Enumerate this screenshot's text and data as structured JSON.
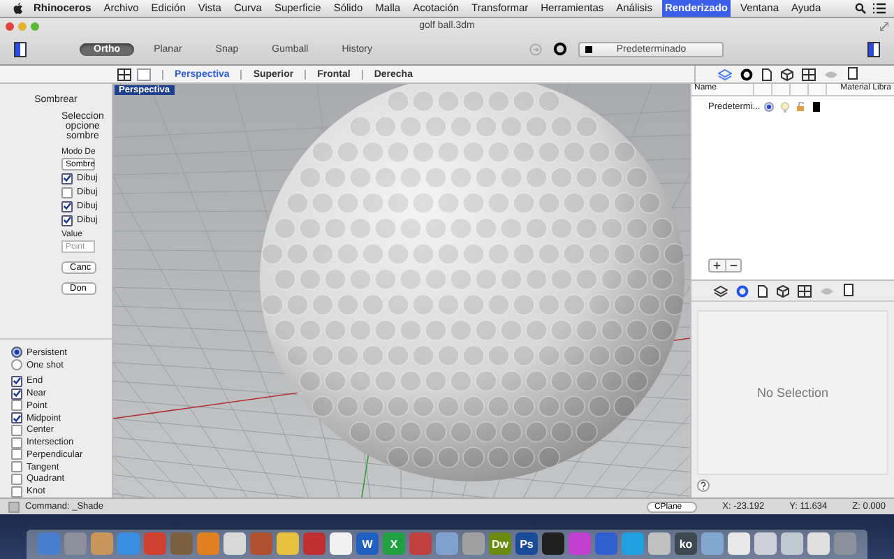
{
  "menubar": {
    "app": "Rhinoceros",
    "items": [
      {
        "label": "Archivo",
        "selected": false
      },
      {
        "label": "Edición",
        "selected": false
      },
      {
        "label": "Vista",
        "selected": false
      },
      {
        "label": "Curva",
        "selected": false
      },
      {
        "label": "Superficie",
        "selected": false
      },
      {
        "label": "Sólido",
        "selected": false
      },
      {
        "label": "Malla",
        "selected": false
      },
      {
        "label": "Acotación",
        "selected": false
      },
      {
        "label": "Transformar",
        "selected": false
      },
      {
        "label": "Herramientas",
        "selected": false
      },
      {
        "label": "Análisis",
        "selected": false
      },
      {
        "label": "Renderizado",
        "selected": true
      },
      {
        "label": "Ventana",
        "selected": false
      },
      {
        "label": "Ayuda",
        "selected": false
      }
    ]
  },
  "window": {
    "title": "golf ball.3dm"
  },
  "toolbar": {
    "toggles": [
      {
        "label": "Ortho",
        "selected": true
      },
      {
        "label": "Planar",
        "selected": false
      },
      {
        "label": "Snap",
        "selected": false
      },
      {
        "label": "Gumball",
        "selected": false
      },
      {
        "label": "History",
        "selected": false
      }
    ],
    "layer_dropdown": "Predeterminado"
  },
  "viewport_tabs": [
    {
      "label": "Perspectiva",
      "selected": true
    },
    {
      "label": "Superior",
      "selected": false
    },
    {
      "label": "Frontal",
      "selected": false
    },
    {
      "label": "Derecha",
      "selected": false
    }
  ],
  "command_panel": {
    "title": "Sombrear",
    "prompt_lines": [
      "Seleccion",
      "opcione",
      "sombre"
    ],
    "mode_label": "Modo De",
    "mode_value": "Sombre",
    "options": [
      {
        "label": "Dibuj",
        "checked": true
      },
      {
        "label": "Dibuj",
        "checked": false
      },
      {
        "label": "Dibuj",
        "checked": true
      },
      {
        "label": "Dibuj",
        "checked": true
      }
    ],
    "value_label": "Value",
    "value_placeholder": "Point",
    "buttons": [
      "Canc",
      "Don"
    ]
  },
  "osnap": {
    "modes": [
      {
        "label": "Persistent",
        "selected": true
      },
      {
        "label": "One shot",
        "selected": false
      }
    ],
    "snaps": [
      {
        "label": "End",
        "checked": true
      },
      {
        "label": "Near",
        "checked": true
      },
      {
        "label": "Point",
        "checked": false
      },
      {
        "label": "Midpoint",
        "checked": true
      },
      {
        "label": "Center",
        "checked": false
      },
      {
        "label": "Intersection",
        "checked": false
      },
      {
        "label": "Perpendicular",
        "checked": false
      },
      {
        "label": "Tangent",
        "checked": false
      },
      {
        "label": "Quadrant",
        "checked": false
      },
      {
        "label": "Knot",
        "checked": false
      }
    ]
  },
  "viewport": {
    "label": "Perspectiva"
  },
  "layers": {
    "columns": [
      "Name",
      "Material Libra"
    ],
    "rows": [
      {
        "name": "Predetermi...",
        "current": true
      }
    ]
  },
  "properties": {
    "empty_text": "No Selection"
  },
  "status_bar": {
    "command": "Command: _Shade",
    "cplane": "CPlane",
    "x": "X: -23.192",
    "y": "Y: 11.634",
    "z": "Z: 0.000"
  },
  "dock": [
    {
      "color": "#4a7fd0"
    },
    {
      "color": "#8a8f99"
    },
    {
      "color": "#c8955a"
    },
    {
      "color": "#3a8de0"
    },
    {
      "color": "#d04030"
    },
    {
      "color": "#7a6040"
    },
    {
      "color": "#e08020"
    },
    {
      "color": "#d8d8d8"
    },
    {
      "color": "#b05030"
    },
    {
      "color": "#e8c040"
    },
    {
      "color": "#c03030"
    },
    {
      "color": "#f0f0f0"
    },
    {
      "color": "#2060c0",
      "label": "W"
    },
    {
      "color": "#20a040",
      "label": "X"
    },
    {
      "color": "#c04040"
    },
    {
      "color": "#80a0d0"
    },
    {
      "color": "#a0a0a0"
    },
    {
      "color": "#6a8a10",
      "label": "Dw"
    },
    {
      "color": "#1a4a9a",
      "label": "Ps"
    },
    {
      "color": "#202020"
    },
    {
      "color": "#c040d0"
    },
    {
      "color": "#3060d0"
    },
    {
      "color": "#20a0e0"
    },
    {
      "color": "#c0c0c0"
    },
    {
      "color": "#3a4a50",
      "label": "ko"
    },
    {
      "color": "#80a8d0"
    },
    {
      "color": "#e8e8e8"
    },
    {
      "color": "#d0d0d8"
    },
    {
      "color": "#c0c8d0"
    },
    {
      "color": "#e0e0e0"
    },
    {
      "color": "#8a9098"
    }
  ]
}
